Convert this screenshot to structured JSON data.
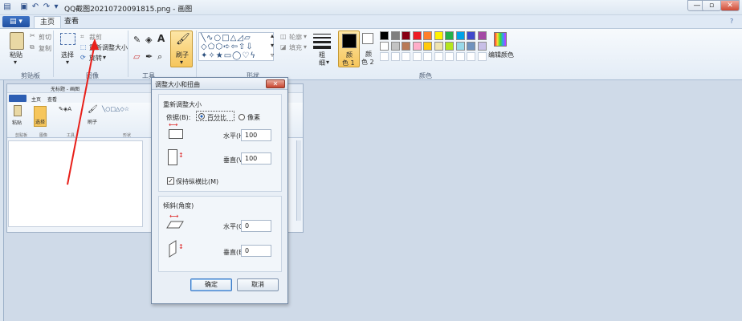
{
  "window": {
    "title": "QQ截图20210720091815.png - 画图"
  },
  "tabs": {
    "home": "主页",
    "view": "查看"
  },
  "clipboard": {
    "paste": "粘贴",
    "cut": "剪切",
    "copy": "复制",
    "group": "剪贴板"
  },
  "image": {
    "select": "选择",
    "crop": "裁剪",
    "resize": "重新调整大小",
    "rotate": "旋转",
    "group": "图像"
  },
  "tools": {
    "group": "工具",
    "brushes": "刷子"
  },
  "shapes": {
    "outline": "轮廓",
    "fill": "填充",
    "group": "形状"
  },
  "size": {
    "label1": "粗",
    "label2": "细"
  },
  "colors": {
    "color1": "颜",
    "color1b": "色 1",
    "color2": "颜",
    "color2b": "色 2",
    "edit": "编辑颜色",
    "group": "颜色",
    "palette_row1": [
      "#000000",
      "#7f7f7f",
      "#880015",
      "#ed1c24",
      "#ff7f27",
      "#fff200",
      "#22b14c",
      "#00a2e8",
      "#3f48cc",
      "#a349a4"
    ],
    "palette_row2": [
      "#ffffff",
      "#c3c3c3",
      "#b97a57",
      "#ffaec9",
      "#ffc90e",
      "#efe4b0",
      "#b5e61d",
      "#99d9ea",
      "#7092be",
      "#c8bfe7"
    ]
  },
  "inner": {
    "title": "无标题 - 画图",
    "tab_home": "主页",
    "tab_view": "查看",
    "paste": "粘贴",
    "select": "选择",
    "brushes": "刷子",
    "g1": "剪贴板",
    "g2": "图像",
    "g3": "工具",
    "g4": "形状"
  },
  "dialog": {
    "title": "调整大小和扭曲",
    "resize_section": "重新调整大小",
    "by_label": "依据(B):",
    "percent": "百分比",
    "pixels": "像素",
    "horizontal": "水平(H):",
    "vertical": "垂直(V):",
    "h_value": "100",
    "v_value": "100",
    "keep_ratio": "保持纵横比(M)",
    "skew_section": "倾斜(角度)",
    "skew_h": "水平(O):",
    "skew_v": "垂直(E):",
    "skew_h_value": "0",
    "skew_v_value": "0",
    "ok": "确定",
    "cancel": "取消"
  }
}
